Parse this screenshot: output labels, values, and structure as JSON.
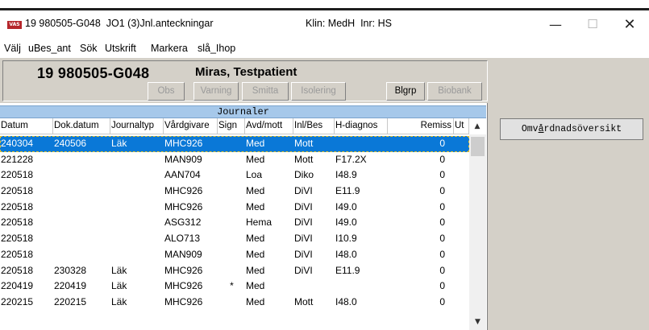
{
  "window": {
    "app_icon_label": "VAS",
    "title": "19 980505-G048  JO1 (3)Jnl.anteckningar",
    "klin": "Klin: MedH  Inr: HS",
    "minimize": "—",
    "maximize": "☐",
    "close": "✕"
  },
  "menu": [
    "Välj",
    "uBes_ant",
    "Sök",
    "Utskrift",
    "Markera",
    "slå_Ihop"
  ],
  "patient": {
    "pnr": "19 980505-G048",
    "name": "Miras, Testpatient"
  },
  "flags": [
    {
      "label": "Obs",
      "active": false
    },
    {
      "label": "Varning",
      "active": false
    },
    {
      "label": "Smitta",
      "active": false
    },
    {
      "label": "Isolering",
      "active": false
    },
    {
      "label": "Blgrp",
      "active": true
    },
    {
      "label": "Biobank",
      "active": false
    }
  ],
  "omv_button": {
    "pre": "Omv",
    "ul": "å",
    "post": "rdnadsöversikt"
  },
  "journal": {
    "heading": "Journaler",
    "columns": [
      "Datum",
      "Dok.datum",
      "Journaltyp",
      "Vårdgivare",
      "Sign",
      "Avd/mott",
      "Inl/Bes",
      "H-diagnos",
      "Remiss",
      "Ut"
    ],
    "rows": [
      [
        "240304",
        "240506",
        "Läk",
        "MHC926",
        "",
        "Med",
        "Mott",
        "",
        "0",
        ""
      ],
      [
        "221228",
        "",
        "",
        "MAN909",
        "",
        "Med",
        "Mott",
        "F17.2X",
        "0",
        ""
      ],
      [
        "220518",
        "",
        "",
        "AAN704",
        "",
        "Loa",
        "Diko",
        "I48.9",
        "0",
        ""
      ],
      [
        "220518",
        "",
        "",
        "MHC926",
        "",
        "Med",
        "DiVI",
        "E11.9",
        "0",
        ""
      ],
      [
        "220518",
        "",
        "",
        "MHC926",
        "",
        "Med",
        "DiVI",
        "I49.0",
        "0",
        ""
      ],
      [
        "220518",
        "",
        "",
        "ASG312",
        "",
        "Hema",
        "DiVI",
        "I49.0",
        "0",
        ""
      ],
      [
        "220518",
        "",
        "",
        "ALO713",
        "",
        "Med",
        "DiVI",
        "I10.9",
        "0",
        ""
      ],
      [
        "220518",
        "",
        "",
        "MAN909",
        "",
        "Med",
        "DiVI",
        "I48.0",
        "0",
        ""
      ],
      [
        "220518",
        "230328",
        "Läk",
        "MHC926",
        "",
        "Med",
        "DiVI",
        "E11.9",
        "0",
        ""
      ],
      [
        "220419",
        "220419",
        "Läk",
        "MHC926",
        "*",
        "Med",
        "",
        "",
        "0",
        ""
      ],
      [
        "220215",
        "220215",
        "Läk",
        "MHC926",
        "",
        "Med",
        "Mott",
        "I48.0",
        "0",
        ""
      ]
    ],
    "selected_row": 0
  },
  "scroll": {
    "up": "▲",
    "down": "▼"
  },
  "colors": {
    "selection": "#0a78d7",
    "header_bg": "#a6c8ea",
    "panel_bg": "#d4d0c8"
  }
}
